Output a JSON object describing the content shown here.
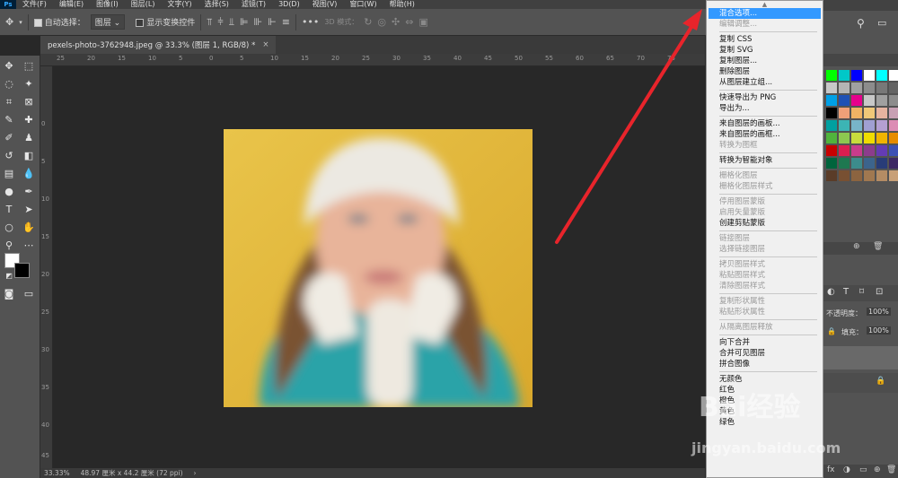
{
  "menubar": {
    "logo": "Ps",
    "items": [
      "文件(F)",
      "编辑(E)",
      "图像(I)",
      "图层(L)",
      "文字(Y)",
      "选择(S)",
      "滤镜(T)",
      "3D(D)",
      "视图(V)",
      "窗口(W)",
      "帮助(H)"
    ]
  },
  "options": {
    "auto_select_label": "自动选择：",
    "auto_select_value": "图层",
    "show_transform_label": "显示变换控件",
    "mode_3d_label": "3D 模式："
  },
  "document_tab": {
    "title": "pexels-photo-3762948.jpeg @ 33.3% (图层 1, RGB/8) *",
    "close": "×"
  },
  "ruler": {
    "h_ticks": [
      "25",
      "20",
      "15",
      "10",
      "5",
      "0",
      "5",
      "10",
      "15",
      "20",
      "25",
      "30",
      "35",
      "40",
      "45",
      "50",
      "55",
      "60",
      "65",
      "70",
      "75"
    ],
    "v_ticks": [
      "0",
      "5",
      "10",
      "15",
      "20",
      "25",
      "30",
      "35",
      "40",
      "45"
    ]
  },
  "status": {
    "zoom": "33.33%",
    "doc_size": "48.97 厘米 x 44.2 厘米 (72 ppi)",
    "arrow": "›"
  },
  "context_menu": {
    "items": [
      {
        "label": "混合选项...",
        "state": "highlight"
      },
      {
        "label": "编辑调整...",
        "state": "disabled"
      },
      {
        "sep": true
      },
      {
        "label": "复制 CSS",
        "state": "normal"
      },
      {
        "label": "复制 SVG",
        "state": "normal"
      },
      {
        "label": "复制图层...",
        "state": "normal"
      },
      {
        "label": "删除图层",
        "state": "normal"
      },
      {
        "label": "从图层建立组...",
        "state": "normal"
      },
      {
        "sep": true
      },
      {
        "label": "快速导出为 PNG",
        "state": "normal"
      },
      {
        "label": "导出为...",
        "state": "normal"
      },
      {
        "sep": true
      },
      {
        "label": "来自图层的画板...",
        "state": "normal"
      },
      {
        "label": "来自图层的画框...",
        "state": "normal"
      },
      {
        "label": "转换为图框",
        "state": "disabled"
      },
      {
        "sep": true
      },
      {
        "label": "转换为智能对象",
        "state": "normal"
      },
      {
        "sep": true
      },
      {
        "label": "栅格化图层",
        "state": "disabled"
      },
      {
        "label": "栅格化图层样式",
        "state": "disabled"
      },
      {
        "sep": true
      },
      {
        "label": "停用图层蒙版",
        "state": "disabled"
      },
      {
        "label": "启用矢量蒙版",
        "state": "disabled"
      },
      {
        "label": "创建剪贴蒙版",
        "state": "normal"
      },
      {
        "sep": true
      },
      {
        "label": "链接图层",
        "state": "disabled"
      },
      {
        "label": "选择链接图层",
        "state": "disabled"
      },
      {
        "sep": true
      },
      {
        "label": "拷贝图层样式",
        "state": "disabled"
      },
      {
        "label": "粘贴图层样式",
        "state": "disabled"
      },
      {
        "label": "清除图层样式",
        "state": "disabled"
      },
      {
        "sep": true
      },
      {
        "label": "复制形状属性",
        "state": "disabled"
      },
      {
        "label": "粘贴形状属性",
        "state": "disabled"
      },
      {
        "sep": true
      },
      {
        "label": "从隔离图层释放",
        "state": "disabled"
      },
      {
        "sep": true
      },
      {
        "label": "向下合并",
        "state": "normal"
      },
      {
        "label": "合并可见图层",
        "state": "normal"
      },
      {
        "label": "拼合图像",
        "state": "normal"
      },
      {
        "sep": true
      },
      {
        "label": "无颜色",
        "state": "normal"
      },
      {
        "label": "红色",
        "state": "normal"
      },
      {
        "label": "橙色",
        "state": "normal"
      },
      {
        "label": "黄色",
        "state": "normal"
      },
      {
        "label": "绿色",
        "state": "normal"
      }
    ]
  },
  "right_panel": {
    "opacity_label": "不透明度：",
    "opacity_value": "100%",
    "fill_label": "填充：",
    "fill_value": "100%",
    "swatch_colors": [
      "#00ff00",
      "#00c8c8",
      "#0000ff",
      "#ffffff",
      "#00ffff",
      "#ffffff",
      "#c8c8c8",
      "#b4b4b4",
      "#a0a0a0",
      "#8c8c8c",
      "#787878",
      "#646464",
      "#00a0e6",
      "#1e50b4",
      "#e6008c",
      "#c8c8c8",
      "#a0a0a0",
      "#8c8c8c",
      "#000000",
      "#f0a078",
      "#f0b464",
      "#f0c878",
      "#e6b4a0",
      "#c8a0b4",
      "#00a0a0",
      "#3cb4b4",
      "#78b4c8",
      "#a0a0d2",
      "#b4a0d2",
      "#dc8cb4",
      "#50b43c",
      "#8cc850",
      "#c8dc3c",
      "#f0dc00",
      "#f0b400",
      "#e68c00",
      "#c80000",
      "#dc1e50",
      "#c83c8c",
      "#8c3c8c",
      "#643cb4",
      "#3c50b4",
      "#00643c",
      "#1e7850",
      "#3c8c8c",
      "#3c648c",
      "#283c78",
      "#3c2864",
      "#5a3c28",
      "#785032",
      "#8c6440",
      "#a07850",
      "#b48c64",
      "#c8a078"
    ]
  },
  "colors": {
    "arrow": "#e8242b",
    "highlight": "#3399ff",
    "photo_bg": "#e3b83a"
  },
  "watermark": {
    "text": "Bai经验",
    "url": "jingyan.baidu.com"
  }
}
